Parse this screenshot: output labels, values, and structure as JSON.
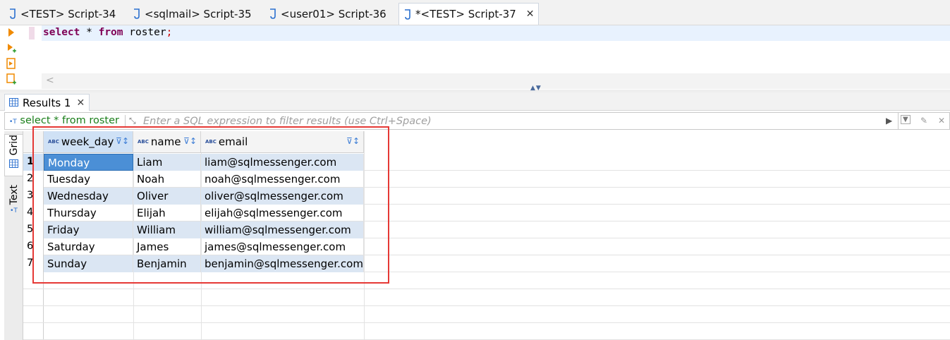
{
  "editor_tabs": [
    {
      "label": "<TEST> Script-34",
      "active": false
    },
    {
      "label": "<sqlmail> Script-35",
      "active": false
    },
    {
      "label": "<user01> Script-36",
      "active": false
    },
    {
      "label": "*<TEST> Script-37",
      "active": true
    }
  ],
  "editor": {
    "code_kw1": "select",
    "code_mid": " * ",
    "code_kw2": "from",
    "code_tail": " roster",
    "code_semi": ";"
  },
  "results_tab": {
    "label": "Results 1"
  },
  "filter": {
    "query": "select * from roster",
    "placeholder": "Enter a SQL expression to filter results (use Ctrl+Space)"
  },
  "side_tabs": {
    "grid": "Grid",
    "text": "Text"
  },
  "table": {
    "columns": [
      "week_day",
      "name",
      "email"
    ],
    "rows": [
      {
        "n": "1",
        "week_day": "Monday",
        "name": "Liam",
        "email": "liam@sqlmessenger.com"
      },
      {
        "n": "2",
        "week_day": "Tuesday",
        "name": "Noah",
        "email": "noah@sqlmessenger.com"
      },
      {
        "n": "3",
        "week_day": "Wednesday",
        "name": "Oliver",
        "email": "oliver@sqlmessenger.com"
      },
      {
        "n": "4",
        "week_day": "Thursday",
        "name": "Elijah",
        "email": "elijah@sqlmessenger.com"
      },
      {
        "n": "5",
        "week_day": "Friday",
        "name": "William",
        "email": "william@sqlmessenger.com"
      },
      {
        "n": "6",
        "week_day": "Saturday",
        "name": "James",
        "email": "james@sqlmessenger.com"
      },
      {
        "n": "7",
        "week_day": "Sunday",
        "name": "Benjamin",
        "email": "benjamin@sqlmessenger.com"
      }
    ]
  },
  "colors": {
    "highlight": "#e53935",
    "keyword": "#7f0055",
    "selected_cell": "#4b8fd6",
    "alt_row": "#dbe6f3"
  }
}
